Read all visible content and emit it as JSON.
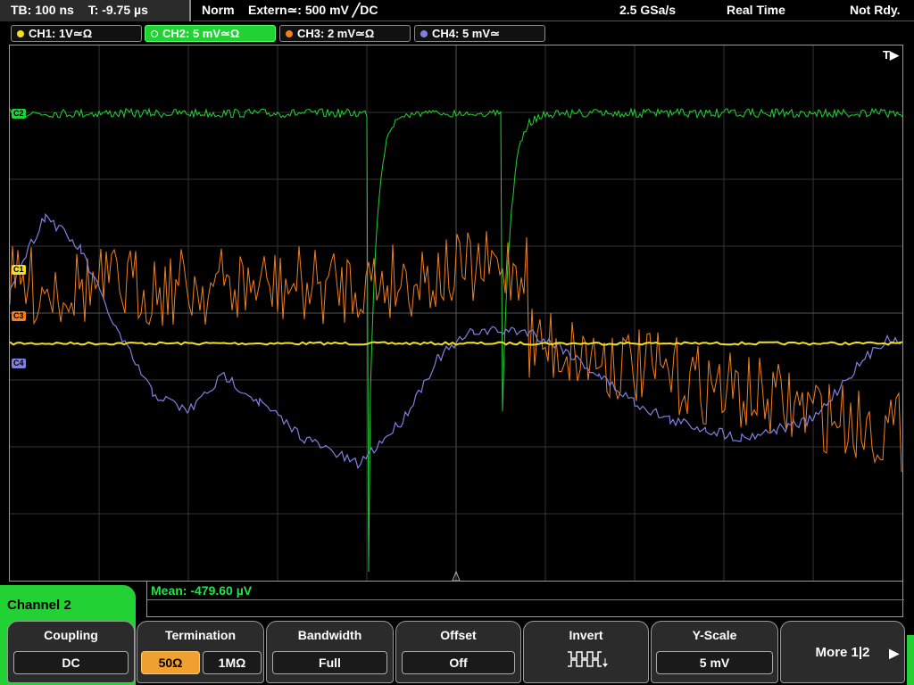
{
  "topbar": {
    "timebase": "TB: 100 ns",
    "trigger_time": "T: -9.75 µs",
    "mode": "Norm",
    "trigger_source": "Extern≃: 500 mV ╱DC",
    "sample_rate": "2.5 GSa/s",
    "acq_mode": "Real Time",
    "status": "Not Rdy."
  },
  "channels": [
    {
      "id": "ch1",
      "label": "CH1: 1V≃Ω",
      "color": "#f0e020",
      "active": false
    },
    {
      "id": "ch2",
      "label": "CH2: 5 mV≃Ω",
      "color": "#22d134",
      "active": true
    },
    {
      "id": "ch3",
      "label": "CH3: 2 mV≃Ω",
      "color": "#f08020",
      "active": false
    },
    {
      "id": "ch4",
      "label": "CH4: 5 mV≃",
      "color": "#8080e0",
      "active": false
    }
  ],
  "screen": {
    "trigger_marker": "T▶",
    "markers": {
      "c2": "C2",
      "c1": "C1",
      "c3": "C3",
      "c4": "C4"
    }
  },
  "measurement": {
    "mean": "Mean: -479.60 µV"
  },
  "panel": {
    "title": "Channel 2"
  },
  "softkeys": {
    "coupling": {
      "title": "Coupling",
      "value": "DC"
    },
    "termination": {
      "title": "Termination",
      "opt1": "50Ω",
      "opt2": "1MΩ"
    },
    "bandwidth": {
      "title": "Bandwidth",
      "value": "Full"
    },
    "offset": {
      "title": "Offset",
      "value": "Off"
    },
    "invert": {
      "title": "Invert",
      "icon": "invert-pulse-icon"
    },
    "yscale": {
      "title": "Y-Scale",
      "value": "5 mV"
    },
    "more": {
      "label": "More 1|2",
      "icon": "arrow-right-icon"
    }
  },
  "colors": {
    "ch1": "#f0e020",
    "ch2": "#22d134",
    "ch3": "#f08020",
    "ch4": "#8080e0",
    "grid": "#3a3a3a",
    "background": "#000000"
  }
}
